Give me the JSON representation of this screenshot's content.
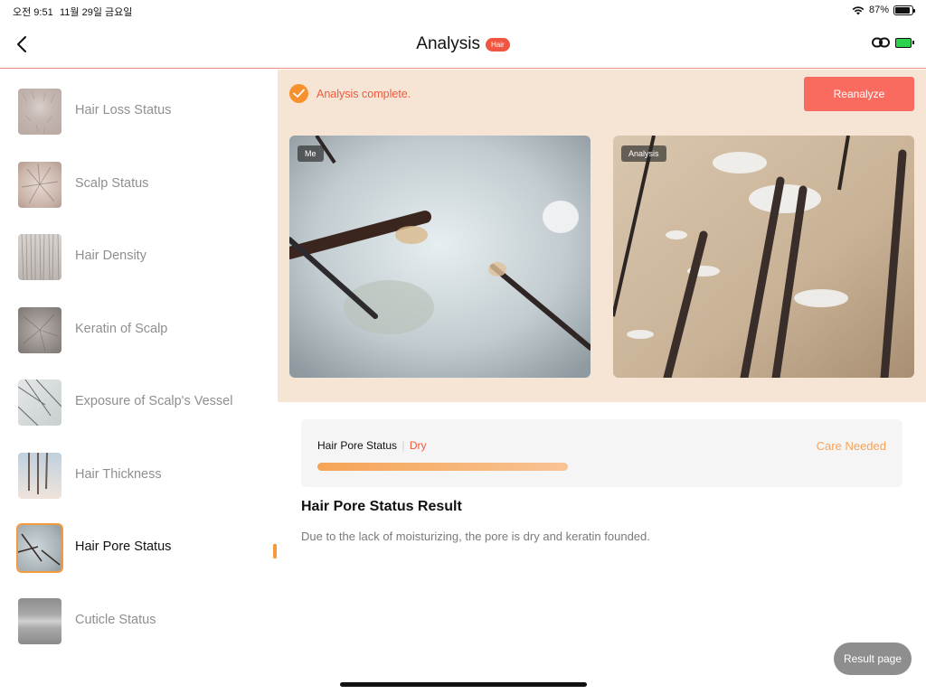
{
  "status_bar": {
    "time": "오전 9:51",
    "date": "11월 29일 금요일",
    "battery_pct": "87%",
    "battery_level": 0.87
  },
  "nav": {
    "title": "Analysis",
    "badge": "Hair",
    "icons": [
      "back-chevron-icon",
      "link-icon",
      "device-battery-icon"
    ],
    "device_battery_color": "#2bd34a"
  },
  "sidebar": {
    "items": [
      {
        "label": "Hair Loss Status",
        "active": false
      },
      {
        "label": "Scalp Status",
        "active": false
      },
      {
        "label": "Hair Density",
        "active": false
      },
      {
        "label": "Keratin of Scalp",
        "active": false
      },
      {
        "label": "Exposure of Scalp's Vessel",
        "active": false
      },
      {
        "label": "Hair Thickness",
        "active": false
      },
      {
        "label": "Hair Pore Status",
        "active": true
      },
      {
        "label": "Cuticle Status",
        "active": false
      }
    ]
  },
  "analysis": {
    "complete_text": "Analysis complete.",
    "reanalyze_label": "Reanalyze",
    "photo_left_tag": "Me",
    "photo_right_tag": "Analysis"
  },
  "result": {
    "status_label": "Hair Pore Status",
    "status_value": "Dry",
    "care_text": "Care Needed",
    "progress": 0.478,
    "title": "Hair Pore Status Result",
    "description": "Due to the lack of moisturizing, the pore is dry and keratin founded.",
    "result_page_label": "Result page"
  },
  "colors": {
    "accent_orange": "#f7902d",
    "accent_red": "#f96b5e",
    "panel_bg": "#f6e4d5"
  }
}
